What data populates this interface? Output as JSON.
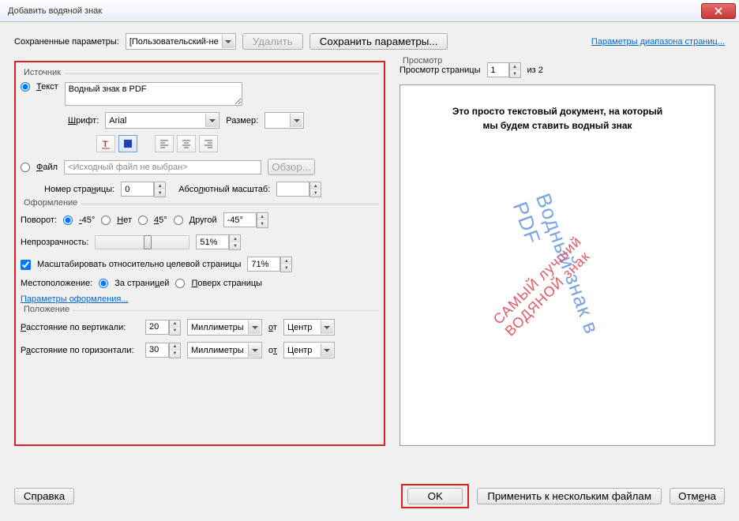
{
  "title": "Добавить водяной знак",
  "saved": {
    "label": "Сохраненные параметры:",
    "value": "[Пользовательский-не",
    "delete": "Удалить",
    "save": "Сохранить параметры...",
    "range_link": "Параметры диапазона страниц..."
  },
  "source": {
    "legend": "Источник",
    "text_radio": "Текст",
    "text_value": "Водный знак в PDF",
    "font_label": "Шрифт:",
    "font_value": "Arial",
    "size_label": "Размер:",
    "size_value": "",
    "file_radio": "Файл",
    "file_value": "<Исходный файл не выбран>",
    "browse": "Обзор...",
    "page_num_label": "Номер страницы:",
    "page_num_value": "0",
    "abs_scale_label": "Абсолютный масштаб:",
    "abs_scale_value": ""
  },
  "appearance": {
    "legend": "Оформление",
    "rotation_label": "Поворот:",
    "r_m45": "-45°",
    "r_none": "Нет",
    "r_45": "45°",
    "r_other": "Другой",
    "r_other_val": "-45°",
    "opacity_label": "Непрозрачность:",
    "opacity_value": "51%",
    "scale_check": "Масштабировать относительно целевой страницы",
    "scale_value": "71%",
    "location_label": "Местоположение:",
    "loc_behind": "За страницей",
    "loc_front": "Поверх страницы",
    "params_link": "Параметры оформления..."
  },
  "position": {
    "legend": "Положение",
    "vdist_label": "Расстояние по вертикали:",
    "vdist_value": "20",
    "hdist_label": "Расстояние по горизонтали:",
    "hdist_value": "30",
    "units": "Миллиметры",
    "from": "от",
    "anchor": "Центр"
  },
  "preview": {
    "legend": "Просмотр",
    "page_label": "Просмотр страницы",
    "page_value": "1",
    "of": "из 2",
    "doc_line1": "Это просто текстовый документ, на который",
    "doc_line2": "мы будем ставить водный знак",
    "wm_blue": "Водный знак в PDF",
    "wm_red": "САМЫЙ лучший ВОДЯНОЙ знак"
  },
  "footer": {
    "help": "Справка",
    "ok": "OK",
    "apply_multi": "Применить к нескольким файлам",
    "cancel": "Отмена"
  }
}
